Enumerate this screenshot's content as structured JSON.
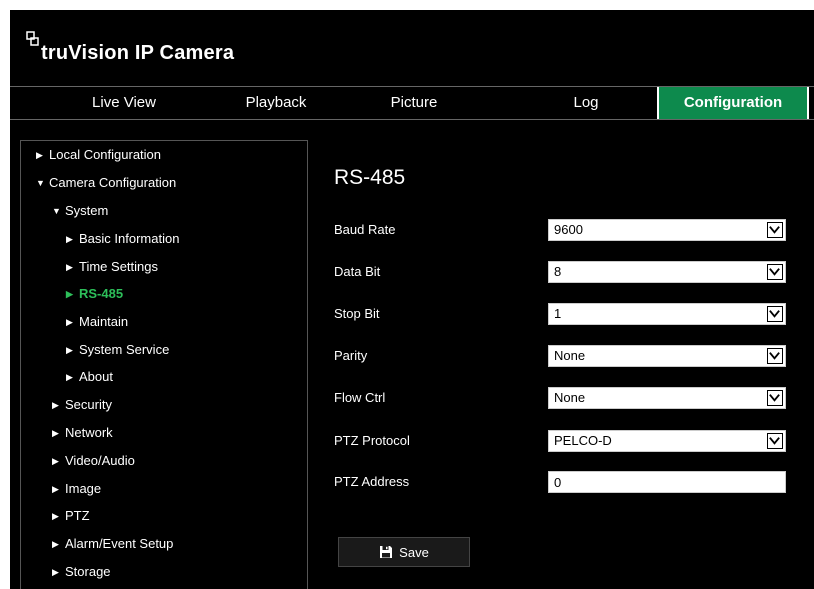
{
  "app": {
    "logo_text": "truVision  IP Camera"
  },
  "nav": {
    "items": [
      {
        "label": "Live View"
      },
      {
        "label": "Playback"
      },
      {
        "label": "Picture"
      },
      {
        "label": "Log"
      },
      {
        "label": "Configuration",
        "active": true
      }
    ]
  },
  "sidebar": {
    "items": [
      {
        "label": "Local Configuration",
        "expanded": false
      },
      {
        "label": "Camera Configuration",
        "expanded": true
      },
      {
        "label": "System",
        "expanded": true
      },
      {
        "label": "Basic Information",
        "expanded": false
      },
      {
        "label": "Time Settings",
        "expanded": false
      },
      {
        "label": "RS-485",
        "selected": true
      },
      {
        "label": "Maintain",
        "expanded": false
      },
      {
        "label": "System Service",
        "expanded": false
      },
      {
        "label": "About",
        "expanded": false
      },
      {
        "label": "Security",
        "expanded": false
      },
      {
        "label": "Network",
        "expanded": false
      },
      {
        "label": "Video/Audio",
        "expanded": false
      },
      {
        "label": "Image",
        "expanded": false
      },
      {
        "label": "PTZ",
        "expanded": false
      },
      {
        "label": "Alarm/Event Setup",
        "expanded": false
      },
      {
        "label": "Storage",
        "expanded": false
      }
    ]
  },
  "content": {
    "title": "RS-485",
    "fields": {
      "baud_rate": {
        "label": "Baud Rate",
        "value": "9600"
      },
      "data_bit": {
        "label": "Data Bit",
        "value": "8"
      },
      "stop_bit": {
        "label": "Stop Bit",
        "value": "1"
      },
      "parity": {
        "label": "Parity",
        "value": "None"
      },
      "flow_ctrl": {
        "label": "Flow Ctrl",
        "value": "None"
      },
      "ptz_protocol": {
        "label": "PTZ Protocol",
        "value": "PELCO-D"
      },
      "ptz_address": {
        "label": "PTZ Address",
        "value": "0"
      }
    },
    "save_label": "Save"
  },
  "colors": {
    "accent": "#0d8a4d",
    "selected_text": "#2dbf5a",
    "background": "#000000"
  },
  "icons": {
    "logo": "camera-link-icon",
    "expand": "triangle-right-icon",
    "collapse": "triangle-down-icon",
    "dropdown": "chevron-down-icon",
    "save": "floppy-disk-icon"
  }
}
